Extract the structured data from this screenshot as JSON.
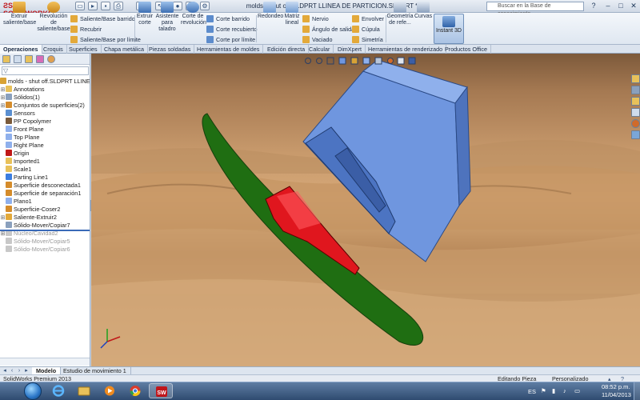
{
  "app": {
    "logo_text": "SOLIDWORKS",
    "document_title": "molds - shut off.SLDPRT LLINEA DE PARTICION.SLDPRT *",
    "search_placeholder": "Buscar en la Base de conocimiento"
  },
  "ribbon": {
    "big_buttons": [
      {
        "id": "extruir-saliente",
        "label": "Extruir saliente/base",
        "icon": "extrude-boss-icon",
        "color": "#d99b2b"
      },
      {
        "id": "revolucion-saliente",
        "label": "Revolución de saliente/base",
        "icon": "revolve-boss-icon",
        "color": "#d99b2b"
      },
      {
        "id": "extruir-corte",
        "label": "Extruir corte",
        "icon": "extrude-cut-icon",
        "color": "#4a7fc2"
      },
      {
        "id": "asistente-taladro",
        "label": "Asistente para taladro",
        "icon": "hole-wizard-icon",
        "color": "#4a7fc2"
      },
      {
        "id": "corte-revolucion",
        "label": "Corte de revolución",
        "icon": "revolve-cut-icon",
        "color": "#4a7fc2"
      },
      {
        "id": "redondeo",
        "label": "Redondeo",
        "icon": "fillet-icon",
        "color": "#6f9ad0"
      },
      {
        "id": "matriz-lineal",
        "label": "Matriz lineal",
        "icon": "linear-pattern-icon",
        "color": "#6f9ad0"
      },
      {
        "id": "geometria-ref",
        "label": "Geometría de refe...",
        "icon": "reference-geometry-icon",
        "color": "#8aa0bd"
      },
      {
        "id": "curvas",
        "label": "Curvas",
        "icon": "curves-icon",
        "color": "#8aa0bd"
      }
    ],
    "small_buttons_col1": [
      "Saliente/Base barrido",
      "Recubrir",
      "Saliente/Base por límite"
    ],
    "small_buttons_col2": [
      "Corte barrido",
      "Corte recubierto",
      "Corte por límite"
    ],
    "small_buttons_col3": [
      "Nervio",
      "Ángulo de salida",
      "Vaciado"
    ],
    "small_buttons_col4": [
      "Envolver",
      "Cúpula",
      "Simetría"
    ],
    "instant3d_label": "Instant 3D"
  },
  "command_tabs": [
    "Operaciones",
    "Croquis",
    "Superficies",
    "Chapa metálica",
    "Piezas soldadas",
    "Herramientas de moldes",
    "Edición directa",
    "Calcular",
    "DimXpert",
    "Herramientas de renderizado",
    "Productos Office"
  ],
  "feature_tree": {
    "root": "molds - shut off.SLDPRT LLINEA D",
    "items": [
      {
        "label": "Annotations",
        "icon": "annotations-icon",
        "expand": "+",
        "grey": false
      },
      {
        "label": "Sólidos(1)",
        "icon": "solid-bodies-icon",
        "expand": "+",
        "grey": false
      },
      {
        "label": "Conjuntos de superficies(2)",
        "icon": "surface-bodies-icon",
        "expand": "+",
        "grey": false
      },
      {
        "label": "Sensors",
        "icon": "sensors-icon",
        "expand": "",
        "grey": false
      },
      {
        "label": "PP Copolymer",
        "icon": "material-icon",
        "expand": "",
        "grey": false
      },
      {
        "label": "Front Plane",
        "icon": "plane-icon",
        "expand": "",
        "grey": false
      },
      {
        "label": "Top Plane",
        "icon": "plane-icon",
        "expand": "",
        "grey": false
      },
      {
        "label": "Right Plane",
        "icon": "plane-icon",
        "expand": "",
        "grey": false
      },
      {
        "label": "Origin",
        "icon": "origin-icon",
        "expand": "",
        "grey": false
      },
      {
        "label": "Imported1",
        "icon": "imported-icon",
        "expand": "",
        "grey": false
      },
      {
        "label": "Scale1",
        "icon": "scale-icon",
        "expand": "",
        "grey": false
      },
      {
        "label": "Parting Line1",
        "icon": "parting-line-icon",
        "expand": "",
        "grey": false
      },
      {
        "label": "Superficie desconectada1",
        "icon": "surface-icon",
        "expand": "",
        "grey": false
      },
      {
        "label": "Superficie de separación1",
        "icon": "surface-icon",
        "expand": "",
        "grey": false
      },
      {
        "label": "Plano1",
        "icon": "plane-icon",
        "expand": "",
        "grey": false
      },
      {
        "label": "Superficie-Coser2",
        "icon": "knit-surface-icon",
        "expand": "",
        "grey": false
      },
      {
        "label": "Saliente-Extruir2",
        "icon": "extrude-boss-icon",
        "expand": "+",
        "grey": false
      },
      {
        "label": "Sólido-Mover/Copiar7",
        "icon": "move-copy-icon",
        "expand": "",
        "grey": false
      },
      {
        "label": "Núcleo/Cavidad2",
        "icon": "core-cavity-icon",
        "expand": "+",
        "grey": true
      },
      {
        "label": "Sólido-Mover/Copiar5",
        "icon": "move-copy-icon",
        "expand": "",
        "grey": true
      },
      {
        "label": "Sólido-Mover/Copiar6",
        "icon": "move-copy-icon",
        "expand": "",
        "grey": true
      }
    ]
  },
  "bottom_tabs": [
    "Modelo",
    "Estudio de movimiento 1"
  ],
  "status": {
    "product": "SolidWorks Premium 2013",
    "mode": "Editando Pieza",
    "units": "Personalizado"
  },
  "taskbar": {
    "language": "ES",
    "time": "08:52 p.m.",
    "date": "11/04/2013"
  },
  "colors": {
    "mold_block": "#6f96df",
    "parting_surface": "#1f6e12",
    "part_body": "#e0161e",
    "accent": "#3a6ab8"
  }
}
